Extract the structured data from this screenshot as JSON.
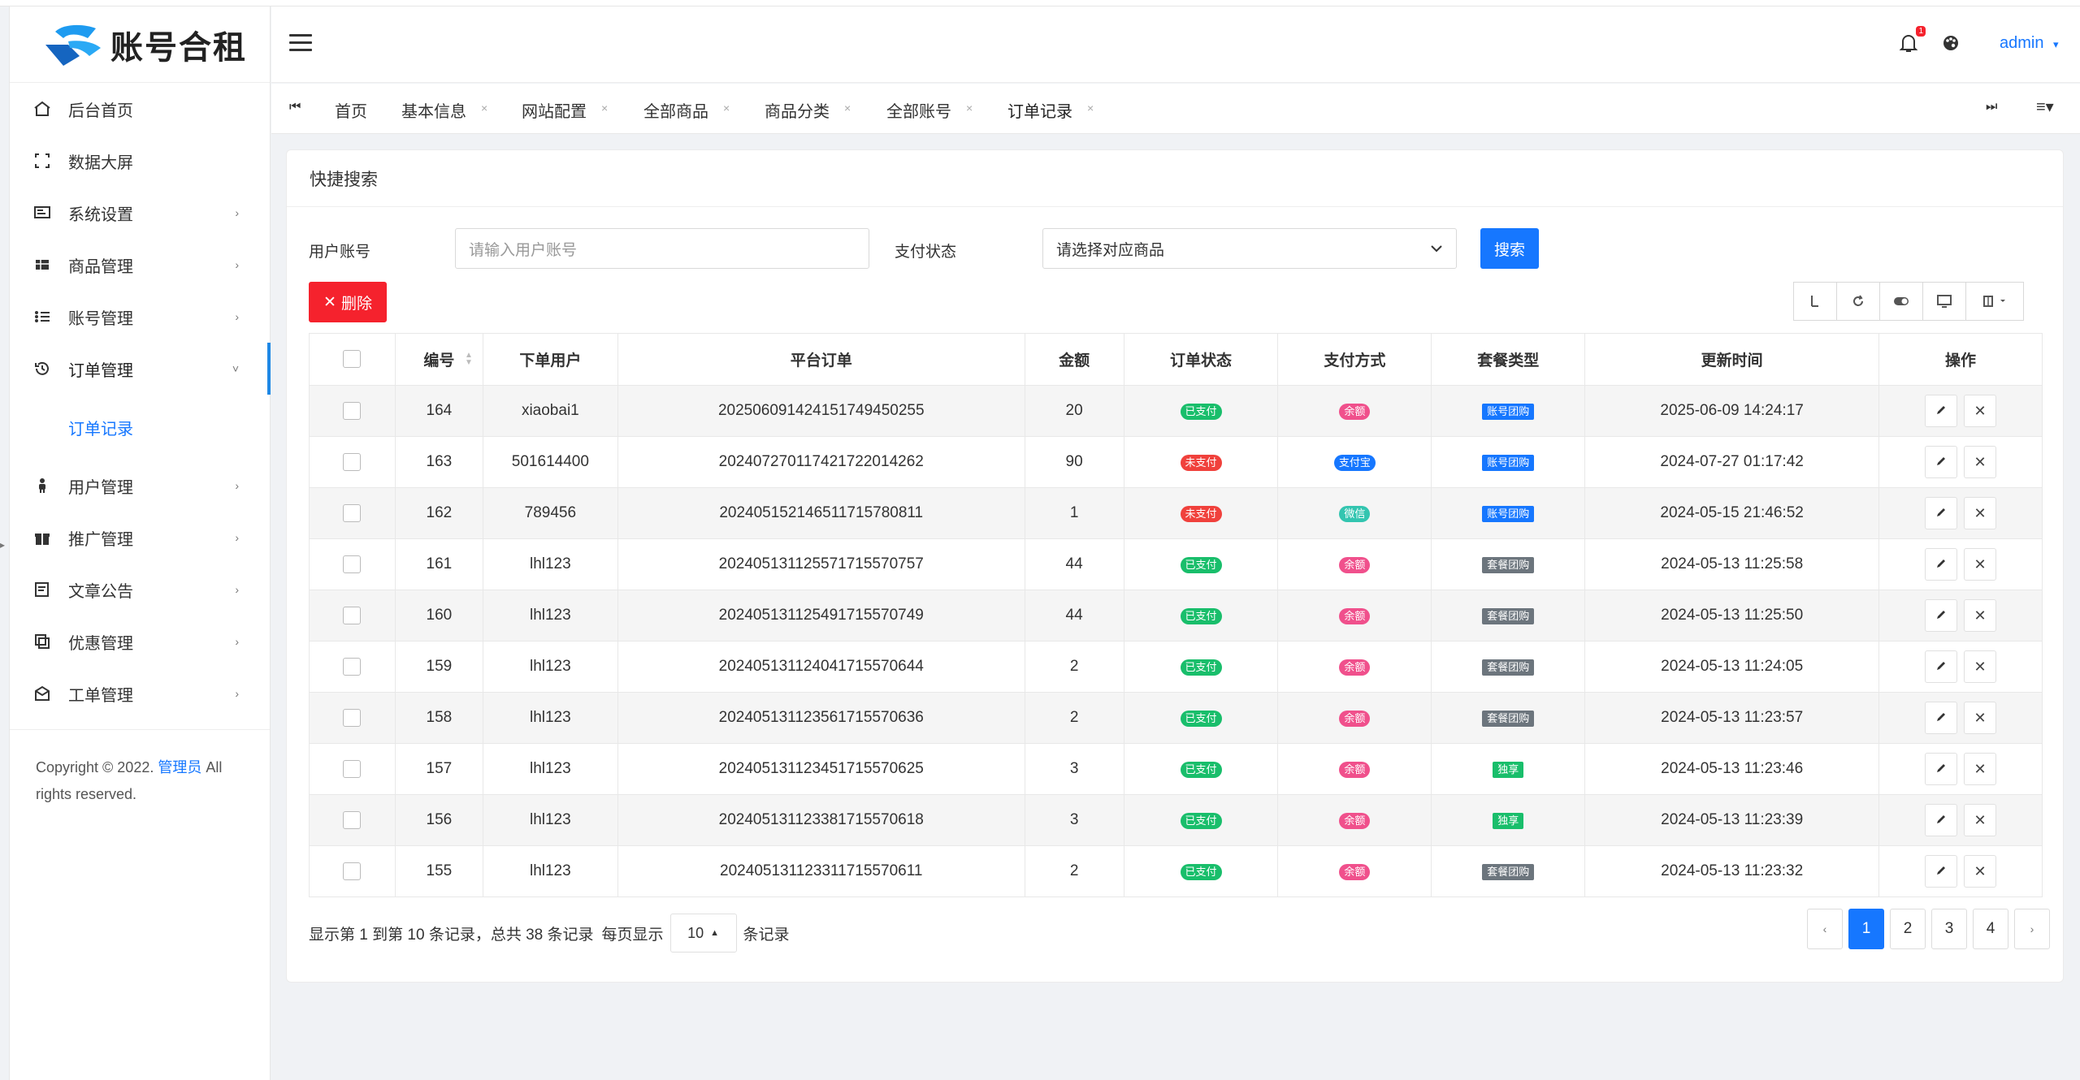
{
  "app": {
    "logo_text": "账号合租"
  },
  "sidebar": {
    "items": [
      {
        "label": "后台首页",
        "icon": "home-icon",
        "has_children": false
      },
      {
        "label": "数据大屏",
        "icon": "screen-icon",
        "has_children": false
      },
      {
        "label": "系统设置",
        "icon": "settings-icon",
        "has_children": true
      },
      {
        "label": "商品管理",
        "icon": "grid-icon",
        "has_children": true
      },
      {
        "label": "账号管理",
        "icon": "list-icon",
        "has_children": true
      },
      {
        "label": "订单管理",
        "icon": "history-icon",
        "has_children": true,
        "expanded": true
      },
      {
        "label": "用户管理",
        "icon": "user-icon",
        "has_children": true
      },
      {
        "label": "推广管理",
        "icon": "gift-icon",
        "has_children": true
      },
      {
        "label": "文章公告",
        "icon": "article-icon",
        "has_children": true
      },
      {
        "label": "优惠管理",
        "icon": "copy-icon",
        "has_children": true
      },
      {
        "label": "工单管理",
        "icon": "inbox-icon",
        "has_children": true
      }
    ],
    "subitem": "订单记录",
    "copyright_prefix": "Copyright © 2022.",
    "copyright_link": "管理员",
    "copyright_suffix": "All rights reserved."
  },
  "header": {
    "user": "admin",
    "notification_count": "1"
  },
  "tabs": [
    {
      "label": "首页",
      "closable": false
    },
    {
      "label": "基本信息",
      "closable": true
    },
    {
      "label": "网站配置",
      "closable": true
    },
    {
      "label": "全部商品",
      "closable": true
    },
    {
      "label": "商品分类",
      "closable": true
    },
    {
      "label": "全部账号",
      "closable": true
    },
    {
      "label": "订单记录",
      "closable": true,
      "active": true
    }
  ],
  "search": {
    "title": "快捷搜索",
    "user_label": "用户账号",
    "user_placeholder": "请输入用户账号",
    "pay_label": "支付状态",
    "pay_select": "请选择对应商品",
    "search_button": "搜索",
    "delete_button": "删除"
  },
  "table": {
    "columns": [
      "编号",
      "下单用户",
      "平台订单",
      "金额",
      "订单状态",
      "支付方式",
      "套餐类型",
      "更新时间",
      "操作"
    ],
    "rows": [
      {
        "id": "164",
        "user": "xiaobai1",
        "order": "20250609142415174945025​5",
        "amount": "20",
        "status": "已支付",
        "pay": "余额",
        "plan": "账号团购",
        "time": "2025-06-09 14:24:17"
      },
      {
        "id": "163",
        "user": "501614400",
        "order": "20240727011742172201426​2",
        "amount": "90",
        "status": "未支付",
        "pay": "支付宝",
        "plan": "账号团购",
        "time": "2024-07-27 01:17:42"
      },
      {
        "id": "162",
        "user": "789456",
        "order": "20240515214651171578081​1",
        "amount": "1",
        "status": "未支付",
        "pay": "微信",
        "plan": "账号团购",
        "time": "2024-05-15 21:46:52"
      },
      {
        "id": "161",
        "user": "lhl123",
        "order": "20240513112557171557075​7",
        "amount": "44",
        "status": "已支付",
        "pay": "余额",
        "plan": "套餐团购",
        "time": "2024-05-13 11:25:58"
      },
      {
        "id": "160",
        "user": "lhl123",
        "order": "20240513112549171557074​9",
        "amount": "44",
        "status": "已支付",
        "pay": "余额",
        "plan": "套餐团购",
        "time": "2024-05-13 11:25:50"
      },
      {
        "id": "159",
        "user": "lhl123",
        "order": "20240513112404171557064​4",
        "amount": "2",
        "status": "已支付",
        "pay": "余额",
        "plan": "套餐团购",
        "time": "2024-05-13 11:24:05"
      },
      {
        "id": "158",
        "user": "lhl123",
        "order": "20240513112356171557063​6",
        "amount": "2",
        "status": "已支付",
        "pay": "余额",
        "plan": "套餐团购",
        "time": "2024-05-13 11:23:57"
      },
      {
        "id": "157",
        "user": "lhl123",
        "order": "20240513112345171557062​5",
        "amount": "3",
        "status": "已支付",
        "pay": "余额",
        "plan": "独享",
        "time": "2024-05-13 11:23:46"
      },
      {
        "id": "156",
        "user": "lhl123",
        "order": "20240513112338171557061​8",
        "amount": "3",
        "status": "已支付",
        "pay": "余额",
        "plan": "独享",
        "time": "2024-05-13 11:23:39"
      },
      {
        "id": "155",
        "user": "lhl123",
        "order": "20240513112331171557061​1",
        "amount": "2",
        "status": "已支付",
        "pay": "余额",
        "plan": "套餐团购",
        "time": "2024-05-13 11:23:32"
      }
    ]
  },
  "pagination": {
    "info": "显示第 1 到第 10 条记录，总共 38 条记录",
    "per_page_label": "每页显示",
    "page_size": "10",
    "per_page_suffix": "条记录",
    "pages": [
      "1",
      "2",
      "3",
      "4"
    ],
    "current": "1",
    "prev": "‹",
    "next": "›"
  },
  "colors": {
    "primary": "#1677ff",
    "danger": "#f5222d",
    "paid": "#19be6b",
    "unpaid": "#f0413c",
    "balance": "#f0508c",
    "alipay": "#1677ff",
    "wechat": "#33c5b0",
    "group_account": "#1677ff",
    "group_plan": "#6c757d",
    "exclusive": "#19be6b"
  }
}
